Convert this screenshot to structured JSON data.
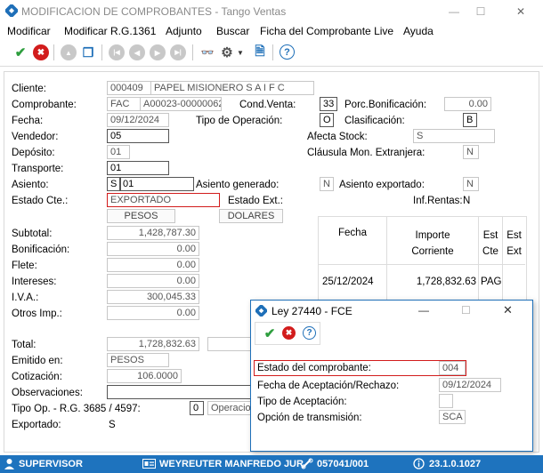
{
  "window": {
    "title": "MODIFICACION DE COMPROBANTES - Tango Ventas",
    "minimize": "—",
    "maximize": "☐",
    "close": "✕"
  },
  "menu": [
    "Modificar",
    "Modificar R.G.1361",
    "Adjunto",
    "Buscar",
    "Ficha del Comprobante Live",
    "Ayuda"
  ],
  "toolbar": {
    "ok": "✔",
    "cancel": "✖",
    "up": "▲",
    "copy": "❐",
    "first": "|◀",
    "prev": "◀",
    "next": "▶",
    "last": "▶|",
    "binoculars": "👓",
    "gear": "⚙",
    "dropdown": "▼",
    "doc_search": "🗎",
    "help": "?"
  },
  "form": {
    "cliente_label": "Cliente:",
    "cliente_code": "000409",
    "cliente_name": "PAPEL MISIONERO S A I F C",
    "comprobante_label": "Comprobante:",
    "comp_type": "FAC",
    "comp_number": "A00023-00000062",
    "cond_venta_label": "Cond.Venta:",
    "cond_venta": "33",
    "porc_bonif_label": "Porc.Bonificación:",
    "porc_bonif": "0.00",
    "fecha_label": "Fecha:",
    "fecha": "09/12/2024",
    "tipo_op_label": "Tipo de Operación:",
    "tipo_op": "O",
    "clasificacion_label": "Clasificación:",
    "clasificacion": "B",
    "vendedor_label": "Vendedor:",
    "vendedor": "05",
    "afecta_stock_label": "Afecta Stock:",
    "afecta_stock": "S",
    "deposito_label": "Depósito:",
    "deposito": "01",
    "clausula_label": "Cláusula Mon. Extranjera:",
    "clausula": "N",
    "transporte_label": "Transporte:",
    "transporte": "01",
    "asiento_label": "Asiento:",
    "asiento_flag": "S",
    "asiento_code": "01",
    "asiento_generado_label": "Asiento generado:",
    "asiento_generado": "N",
    "asiento_exportado_label": "Asiento exportado:",
    "asiento_exportado": "N",
    "estado_cte_label": "Estado Cte.:",
    "estado_cte": "EXPORTADO",
    "estado_ext_label": "Estado Ext.:",
    "inf_rentas_label": "Inf.Rentas:",
    "inf_rentas": "N",
    "moneda_btn": "PESOS",
    "dolares_btn": "DOLARES",
    "subtotal_label": "Subtotal:",
    "subtotal": "1,428,787.30",
    "bonificacion_label": "Bonificación:",
    "bonificacion": "0.00",
    "flete_label": "Flete:",
    "flete": "0.00",
    "intereses_label": "Intereses:",
    "intereses": "0.00",
    "iva_label": "I.V.A.:",
    "iva": "300,045.33",
    "otros_imp_label": "Otros Imp.:",
    "otros_imp": "0.00",
    "total_label": "Total:",
    "total": "1,728,832.63",
    "emitido_label": "Emitido en:",
    "emitido": "PESOS",
    "cotizacion_label": "Cotización:",
    "cotizacion": "106.0000",
    "observaciones_label": "Observaciones:",
    "observaciones": "",
    "tipo_op_rg_label": "Tipo Op. - R.G. 3685 / 4597:",
    "tipo_op_rg_code": "0",
    "tipo_op_rg_text": "Operacio",
    "exportado_label": "Exportado:",
    "exportado": "S"
  },
  "grid": {
    "headers": [
      "Fecha",
      "Importe\nCorriente",
      "Est\nCte",
      "Est\nExt"
    ],
    "rows": [
      [
        "25/12/2024",
        "1,728,832.63",
        "PAG",
        ""
      ]
    ]
  },
  "dialog": {
    "title": "Ley 27440 - FCE",
    "estado_label": "Estado del comprobante:",
    "estado": "004",
    "fecha_acep_label": "Fecha de Aceptación/Rechazo:",
    "fecha_acep": "09/12/2024",
    "tipo_acep_label": "Tipo de Aceptación:",
    "tipo_acep": "",
    "opcion_label": "Opción de transmisión:",
    "opcion": "SCA"
  },
  "status": {
    "user": "SUPERVISOR",
    "name": "WEYREUTER MANFREDO JUR",
    "code": "057041/001",
    "version": "23.1.0.1027"
  },
  "colors": {
    "accent": "#1e73be",
    "ok": "#2e9e3e",
    "cancel": "#d21c1c",
    "help": "#1e6fb8",
    "highlight": "#d21c1c"
  }
}
